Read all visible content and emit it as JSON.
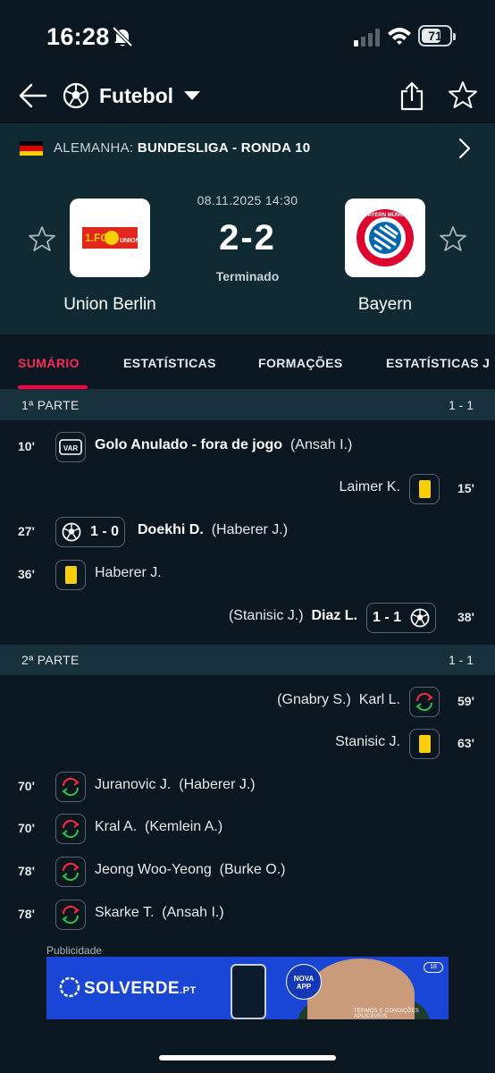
{
  "status_bar": {
    "time": "16:28",
    "battery": "71"
  },
  "app_bar": {
    "sport": "Futebol"
  },
  "league": {
    "country": "ALEMANHA:",
    "competition": "BUNDESLIGA - RONDA 10"
  },
  "match": {
    "datetime": "08.11.2025 14:30",
    "score": "2-2",
    "status": "Terminado",
    "home": {
      "name": "Union Berlin",
      "logo_text": "UNION"
    },
    "away": {
      "name": "Bayern",
      "logo_text": "FC BAYERN MÜNCHEN"
    }
  },
  "tabs": [
    "SUMÁRIO",
    "ESTATÍSTICAS",
    "FORMAÇÕES",
    "ESTATÍSTICAS J"
  ],
  "sections": [
    {
      "label": "1ª PARTE",
      "score": "1 - 1"
    },
    {
      "label": "2ª PARTE",
      "score": "1 - 1"
    }
  ],
  "events": {
    "e1": {
      "minute": "10'",
      "icon_label": "VAR",
      "title": "Golo Anulado - fora de jogo",
      "detail": "(Ansah I.)"
    },
    "e2": {
      "minute": "15'",
      "player": "Laimer K."
    },
    "e3": {
      "minute": "27'",
      "goal_score": "1 - 0",
      "player": "Doekhi D.",
      "assist": "(Haberer J.)"
    },
    "e4": {
      "minute": "36'",
      "player": "Haberer J."
    },
    "e5": {
      "minute": "38'",
      "goal_score": "1 - 1",
      "player": "Diaz L.",
      "assist": "(Stanisic J.)"
    },
    "e6": {
      "minute": "59'",
      "player_in": "Karl L.",
      "player_out": "(Gnabry S.)"
    },
    "e7": {
      "minute": "63'",
      "player": "Stanisic J."
    },
    "e8": {
      "minute": "70'",
      "player_in": "Juranovic J.",
      "player_out": "(Haberer J.)"
    },
    "e9": {
      "minute": "70'",
      "player_in": "Kral A.",
      "player_out": "(Kemlein A.)"
    },
    "e10": {
      "minute": "78'",
      "player_in": "Jeong Woo-Yeong",
      "player_out": "(Burke O.)"
    },
    "e11": {
      "minute": "78'",
      "player_in": "Skarke T.",
      "player_out": "(Ansah I.)"
    }
  },
  "ad": {
    "label": "Publicidade",
    "brand": "SOLVERDE",
    "brand_suffix": ".PT",
    "badge": "NOVA APP",
    "terms": "TERMOS E CONDIÇÕES APLICÁVEIS",
    "age": "18"
  },
  "colors": {
    "background": "#0a1620",
    "header": "#0f2a33",
    "accent": "#ff0046",
    "yellow_card": "#fbce0c",
    "sub_in": "#2fbf4f",
    "sub_out": "#ff2a3a"
  }
}
